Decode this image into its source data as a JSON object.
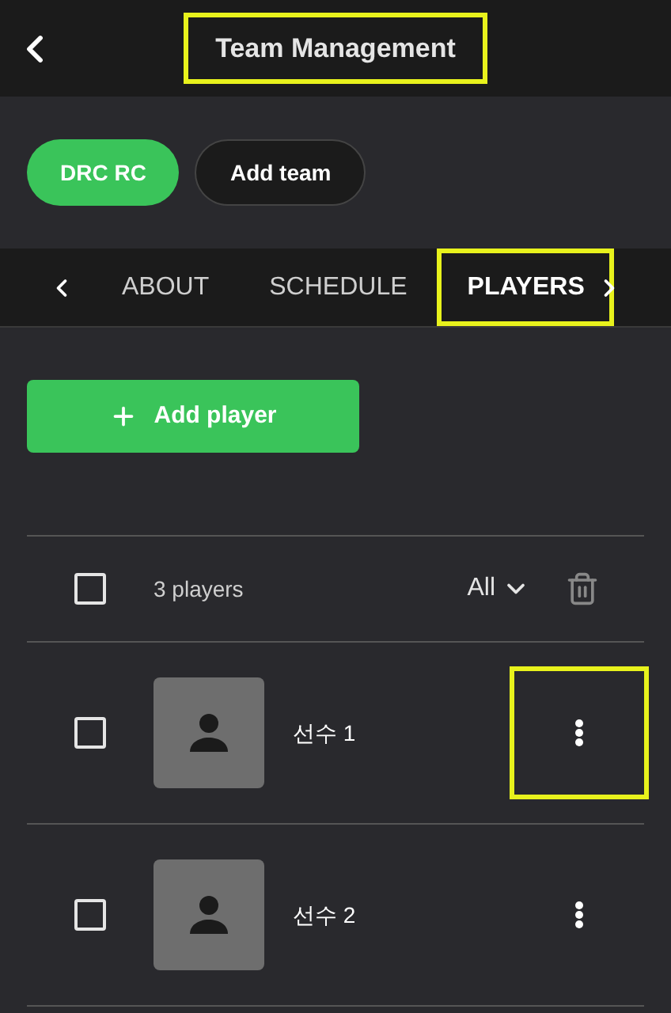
{
  "header": {
    "title": "Team Management",
    "highlighted": true
  },
  "teams": [
    {
      "label": "DRC RC",
      "selected": true
    },
    {
      "label": "Add team",
      "selected": false
    }
  ],
  "tabs": [
    {
      "label": "ABOUT",
      "selected": false,
      "highlighted": false
    },
    {
      "label": "SCHEDULE",
      "selected": false,
      "highlighted": false
    },
    {
      "label": "PLAYERS",
      "selected": true,
      "highlighted": true
    }
  ],
  "add_player": {
    "label": "Add player"
  },
  "list_header": {
    "checked": false,
    "count": "3 players",
    "filter": "All"
  },
  "players": [
    {
      "name": "선수 1",
      "checked": false,
      "menu_highlighted": true
    },
    {
      "name": "선수 2",
      "checked": false,
      "menu_highlighted": false
    }
  ]
}
